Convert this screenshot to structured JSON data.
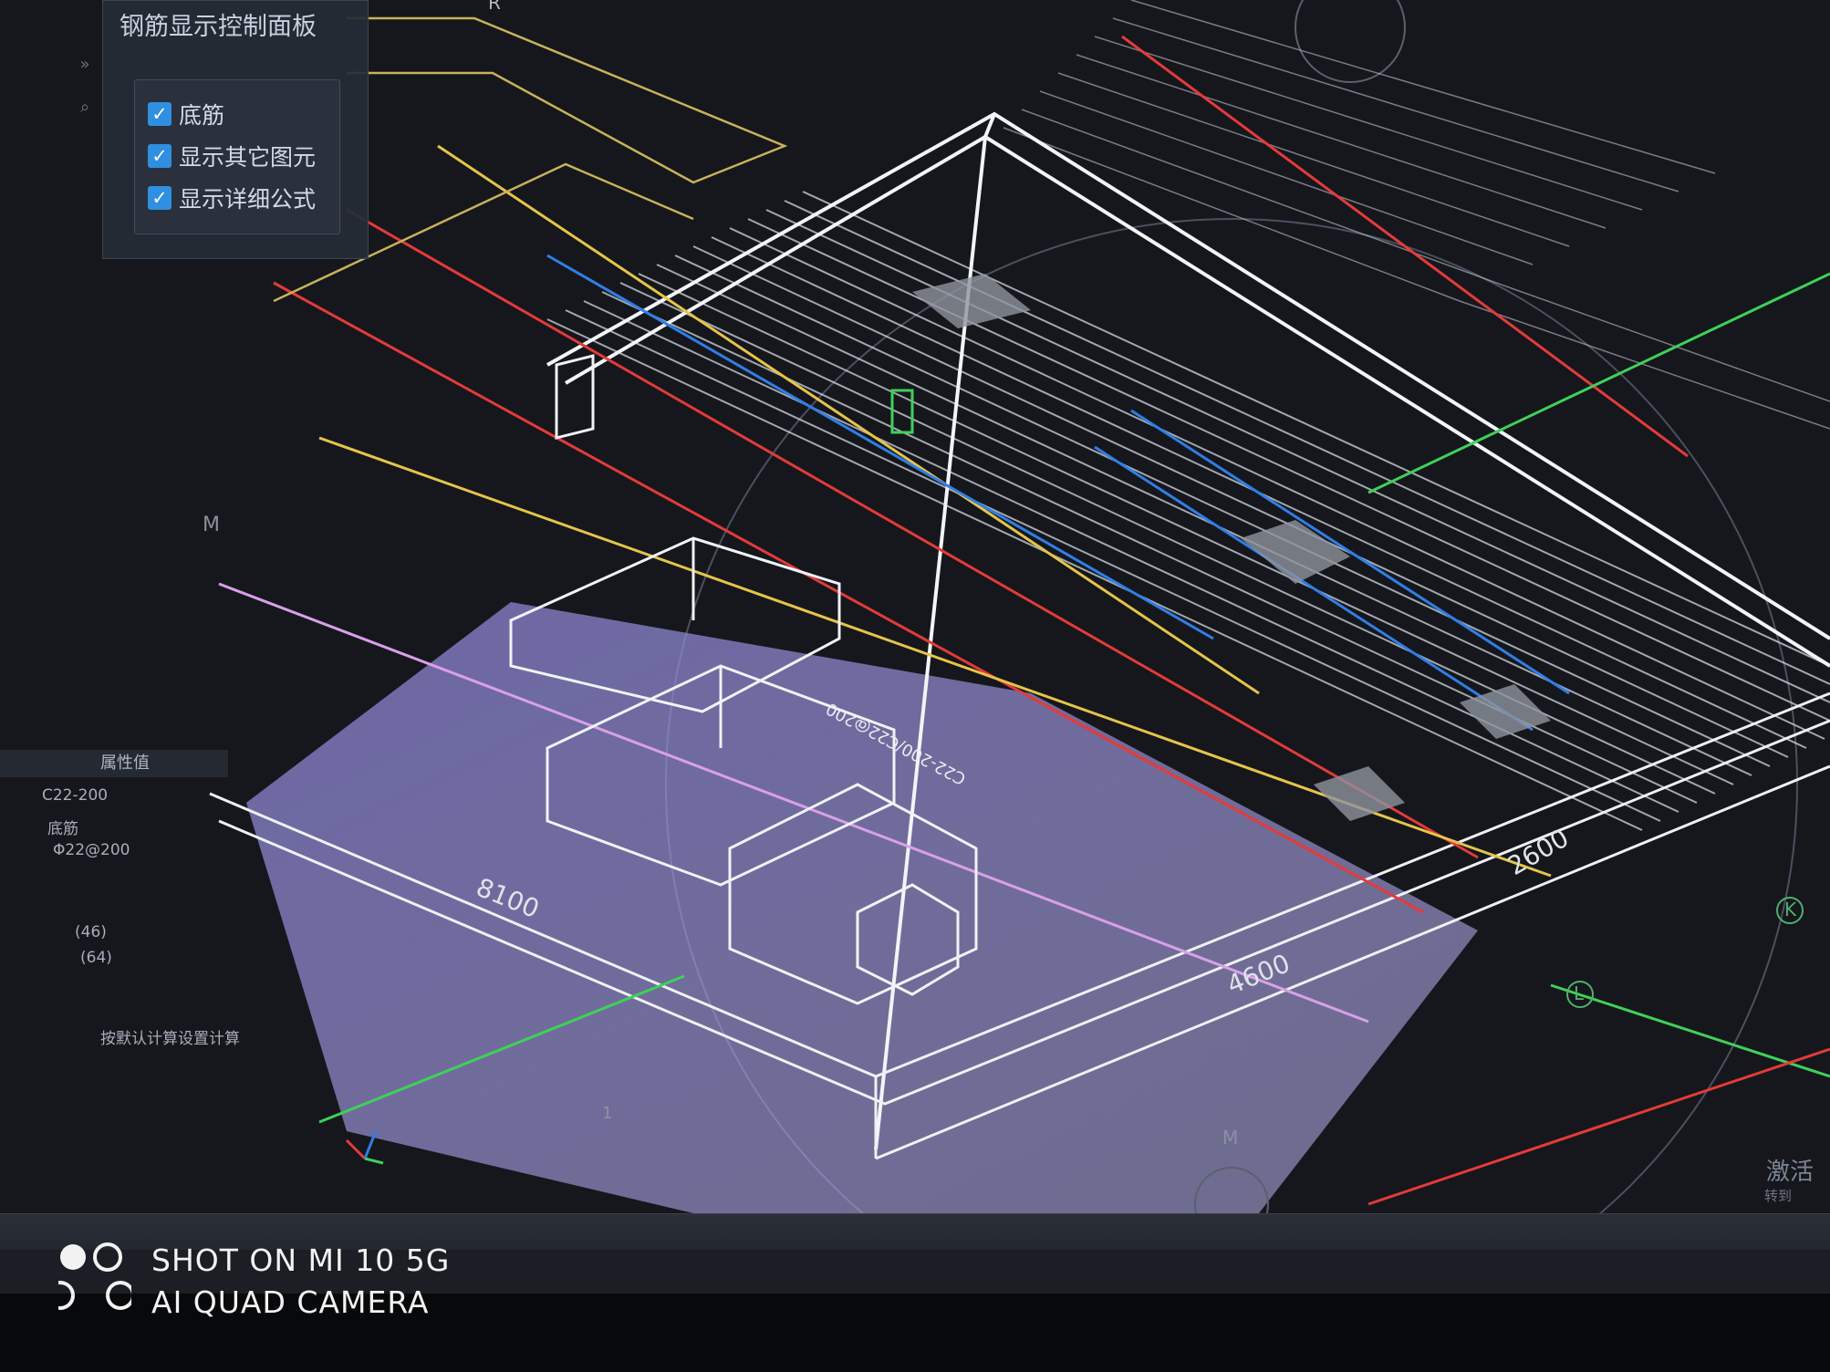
{
  "panel": {
    "title": "钢筋显示控制面板",
    "checkboxes": [
      {
        "label": "底筋",
        "checked": true
      },
      {
        "label": "显示其它图元",
        "checked": true
      },
      {
        "label": "显示详细公式",
        "checked": true
      }
    ]
  },
  "property_table": {
    "header": "属性值",
    "rows": [
      "C22-200",
      "底筋",
      "Φ22@200",
      "(46)",
      "(64)",
      "按默认计算设置计算"
    ]
  },
  "dimensions": {
    "d1": "8100",
    "d2": "4600",
    "d3": "2600"
  },
  "rebar_labels": {
    "l1": "C22-200/C22@200"
  },
  "axis_labels": {
    "k": "K",
    "l": "L",
    "m": "M",
    "m2": "M",
    "r": "R",
    "one": "1"
  },
  "desktop": {
    "activate_title": "激活",
    "activate_sub": "转到"
  },
  "watermark": {
    "line1": "SHOT ON MI 10 5G",
    "line2": "AI QUAD CAMERA"
  },
  "colors": {
    "slab_fill": "#8a82d4",
    "rebar_white": "#e8ecf2",
    "rebar_red": "#e43a3a",
    "rebar_yellow": "#e6c44a",
    "rebar_blue": "#2f7ee8",
    "rebar_green": "#3fd05a",
    "rebar_pink": "#d9a0e8",
    "checkbox": "#2f8fe0"
  }
}
